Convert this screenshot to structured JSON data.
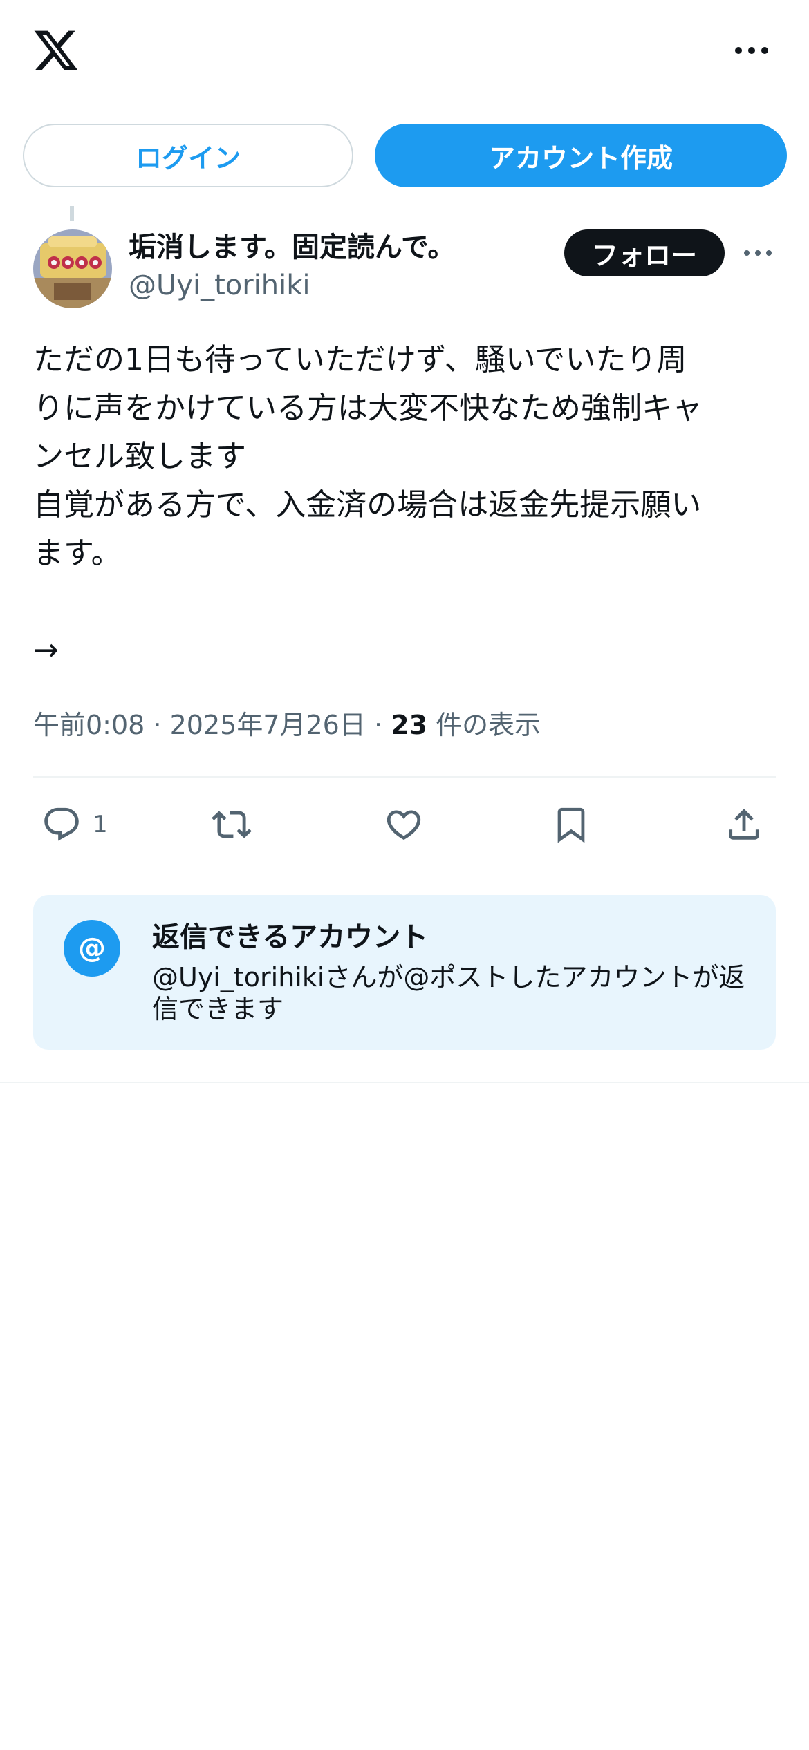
{
  "header": {
    "logo_icon": "x-logo-icon",
    "more_icon": "more-horizontal-icon",
    "login_label": "ログイン",
    "signup_label": "アカウント作成"
  },
  "tweet": {
    "display_name": "垢消します。固定読んで。",
    "handle": "@Uyi_torihiki",
    "follow_label": "フォロー",
    "text": "ただの1日も待っていただけず、騒いでいたり周\nりに声をかけている方は大変不快なため強制キャ\nンセル致します\n自覚がある方で、入金済の場合は返金先提示願い\nます。\n\n→",
    "time": "午前0:08",
    "separator": "·",
    "date": "2025年7月26日",
    "view_count": "23",
    "view_label": "件の表示",
    "reply_count": "1"
  },
  "actions": {
    "icons": [
      "reply-icon",
      "retweet-icon",
      "like-icon",
      "bookmark-icon",
      "share-icon"
    ]
  },
  "reply_notice": {
    "badge": "@",
    "title": "返信できるアカウント",
    "body": "@Uyi_torihikiさんが@ポストしたアカウントが返信できます"
  },
  "colors": {
    "accent": "#1d9bf0",
    "text": "#0f1419",
    "secondary": "#536471",
    "notice_bg": "#e8f5fd"
  }
}
